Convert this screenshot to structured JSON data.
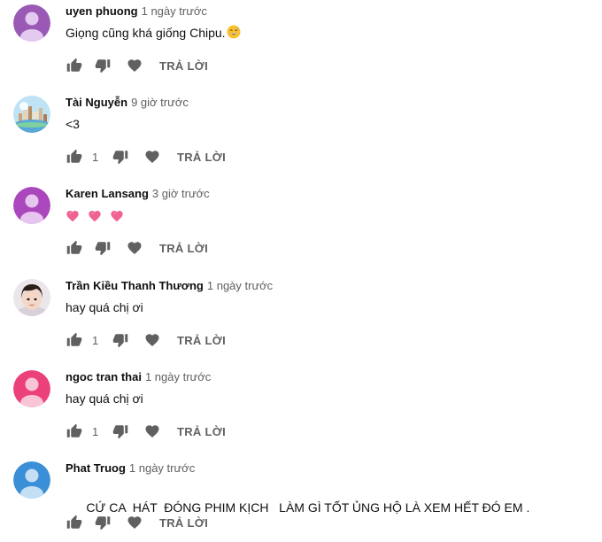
{
  "reply_label": "TRẢ LỜI",
  "comments": [
    {
      "author": "uyen phuong",
      "time": "1 ngày trước",
      "text": "Giọng cũng khá giống Chipu.",
      "emoji": "grinning-sweat",
      "likes": "",
      "avatar": {
        "type": "default",
        "color": "#9b59b6"
      }
    },
    {
      "author": "Tài Nguyễn",
      "time": "9 giờ trước",
      "text": "<3",
      "likes": "1",
      "avatar": {
        "type": "photo-landscape"
      }
    },
    {
      "author": "Karen Lansang",
      "time": "3 giờ trước",
      "text": "",
      "emoji": "three-pink-hearts",
      "likes": "",
      "avatar": {
        "type": "default",
        "color": "#ab47bc"
      }
    },
    {
      "author": "Trần Kiều Thanh Thương",
      "time": "1 ngày trước",
      "text": "hay quá chị ơi",
      "likes": "1",
      "avatar": {
        "type": "photo-face"
      }
    },
    {
      "author": "ngoc tran thai",
      "time": "1 ngày trước",
      "text": "hay quá chị ơi",
      "likes": "1",
      "avatar": {
        "type": "default",
        "color": "#ec407a"
      }
    },
    {
      "author": "Phat Truog",
      "time": "1 ngày trước",
      "text": "CỨ CA  HÁT  ĐÓNG PHIM KỊCH   LÀM GÌ TỐT ỦNG HỘ LÀ XEM HẾT ĐÓ EM .",
      "likes": "",
      "avatar": {
        "type": "default",
        "color": "#3b8fd6"
      }
    }
  ]
}
